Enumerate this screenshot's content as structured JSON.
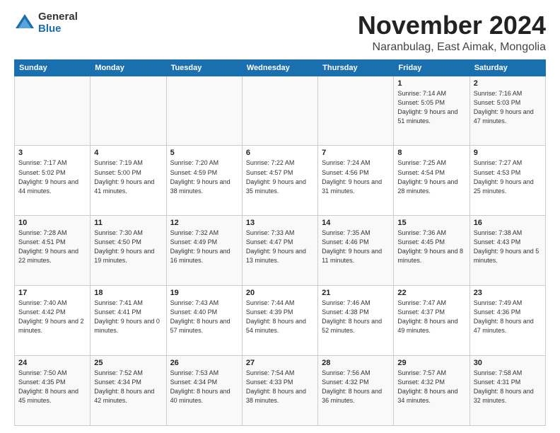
{
  "logo": {
    "general": "General",
    "blue": "Blue"
  },
  "title": "November 2024",
  "location": "Naranbulag, East Aimak, Mongolia",
  "days_of_week": [
    "Sunday",
    "Monday",
    "Tuesday",
    "Wednesday",
    "Thursday",
    "Friday",
    "Saturday"
  ],
  "weeks": [
    [
      {
        "day": "",
        "info": ""
      },
      {
        "day": "",
        "info": ""
      },
      {
        "day": "",
        "info": ""
      },
      {
        "day": "",
        "info": ""
      },
      {
        "day": "",
        "info": ""
      },
      {
        "day": "1",
        "info": "Sunrise: 7:14 AM\nSunset: 5:05 PM\nDaylight: 9 hours and 51 minutes."
      },
      {
        "day": "2",
        "info": "Sunrise: 7:16 AM\nSunset: 5:03 PM\nDaylight: 9 hours and 47 minutes."
      }
    ],
    [
      {
        "day": "3",
        "info": "Sunrise: 7:17 AM\nSunset: 5:02 PM\nDaylight: 9 hours and 44 minutes."
      },
      {
        "day": "4",
        "info": "Sunrise: 7:19 AM\nSunset: 5:00 PM\nDaylight: 9 hours and 41 minutes."
      },
      {
        "day": "5",
        "info": "Sunrise: 7:20 AM\nSunset: 4:59 PM\nDaylight: 9 hours and 38 minutes."
      },
      {
        "day": "6",
        "info": "Sunrise: 7:22 AM\nSunset: 4:57 PM\nDaylight: 9 hours and 35 minutes."
      },
      {
        "day": "7",
        "info": "Sunrise: 7:24 AM\nSunset: 4:56 PM\nDaylight: 9 hours and 31 minutes."
      },
      {
        "day": "8",
        "info": "Sunrise: 7:25 AM\nSunset: 4:54 PM\nDaylight: 9 hours and 28 minutes."
      },
      {
        "day": "9",
        "info": "Sunrise: 7:27 AM\nSunset: 4:53 PM\nDaylight: 9 hours and 25 minutes."
      }
    ],
    [
      {
        "day": "10",
        "info": "Sunrise: 7:28 AM\nSunset: 4:51 PM\nDaylight: 9 hours and 22 minutes."
      },
      {
        "day": "11",
        "info": "Sunrise: 7:30 AM\nSunset: 4:50 PM\nDaylight: 9 hours and 19 minutes."
      },
      {
        "day": "12",
        "info": "Sunrise: 7:32 AM\nSunset: 4:49 PM\nDaylight: 9 hours and 16 minutes."
      },
      {
        "day": "13",
        "info": "Sunrise: 7:33 AM\nSunset: 4:47 PM\nDaylight: 9 hours and 13 minutes."
      },
      {
        "day": "14",
        "info": "Sunrise: 7:35 AM\nSunset: 4:46 PM\nDaylight: 9 hours and 11 minutes."
      },
      {
        "day": "15",
        "info": "Sunrise: 7:36 AM\nSunset: 4:45 PM\nDaylight: 9 hours and 8 minutes."
      },
      {
        "day": "16",
        "info": "Sunrise: 7:38 AM\nSunset: 4:43 PM\nDaylight: 9 hours and 5 minutes."
      }
    ],
    [
      {
        "day": "17",
        "info": "Sunrise: 7:40 AM\nSunset: 4:42 PM\nDaylight: 9 hours and 2 minutes."
      },
      {
        "day": "18",
        "info": "Sunrise: 7:41 AM\nSunset: 4:41 PM\nDaylight: 9 hours and 0 minutes."
      },
      {
        "day": "19",
        "info": "Sunrise: 7:43 AM\nSunset: 4:40 PM\nDaylight: 8 hours and 57 minutes."
      },
      {
        "day": "20",
        "info": "Sunrise: 7:44 AM\nSunset: 4:39 PM\nDaylight: 8 hours and 54 minutes."
      },
      {
        "day": "21",
        "info": "Sunrise: 7:46 AM\nSunset: 4:38 PM\nDaylight: 8 hours and 52 minutes."
      },
      {
        "day": "22",
        "info": "Sunrise: 7:47 AM\nSunset: 4:37 PM\nDaylight: 8 hours and 49 minutes."
      },
      {
        "day": "23",
        "info": "Sunrise: 7:49 AM\nSunset: 4:36 PM\nDaylight: 8 hours and 47 minutes."
      }
    ],
    [
      {
        "day": "24",
        "info": "Sunrise: 7:50 AM\nSunset: 4:35 PM\nDaylight: 8 hours and 45 minutes."
      },
      {
        "day": "25",
        "info": "Sunrise: 7:52 AM\nSunset: 4:34 PM\nDaylight: 8 hours and 42 minutes."
      },
      {
        "day": "26",
        "info": "Sunrise: 7:53 AM\nSunset: 4:34 PM\nDaylight: 8 hours and 40 minutes."
      },
      {
        "day": "27",
        "info": "Sunrise: 7:54 AM\nSunset: 4:33 PM\nDaylight: 8 hours and 38 minutes."
      },
      {
        "day": "28",
        "info": "Sunrise: 7:56 AM\nSunset: 4:32 PM\nDaylight: 8 hours and 36 minutes."
      },
      {
        "day": "29",
        "info": "Sunrise: 7:57 AM\nSunset: 4:32 PM\nDaylight: 8 hours and 34 minutes."
      },
      {
        "day": "30",
        "info": "Sunrise: 7:58 AM\nSunset: 4:31 PM\nDaylight: 8 hours and 32 minutes."
      }
    ]
  ]
}
